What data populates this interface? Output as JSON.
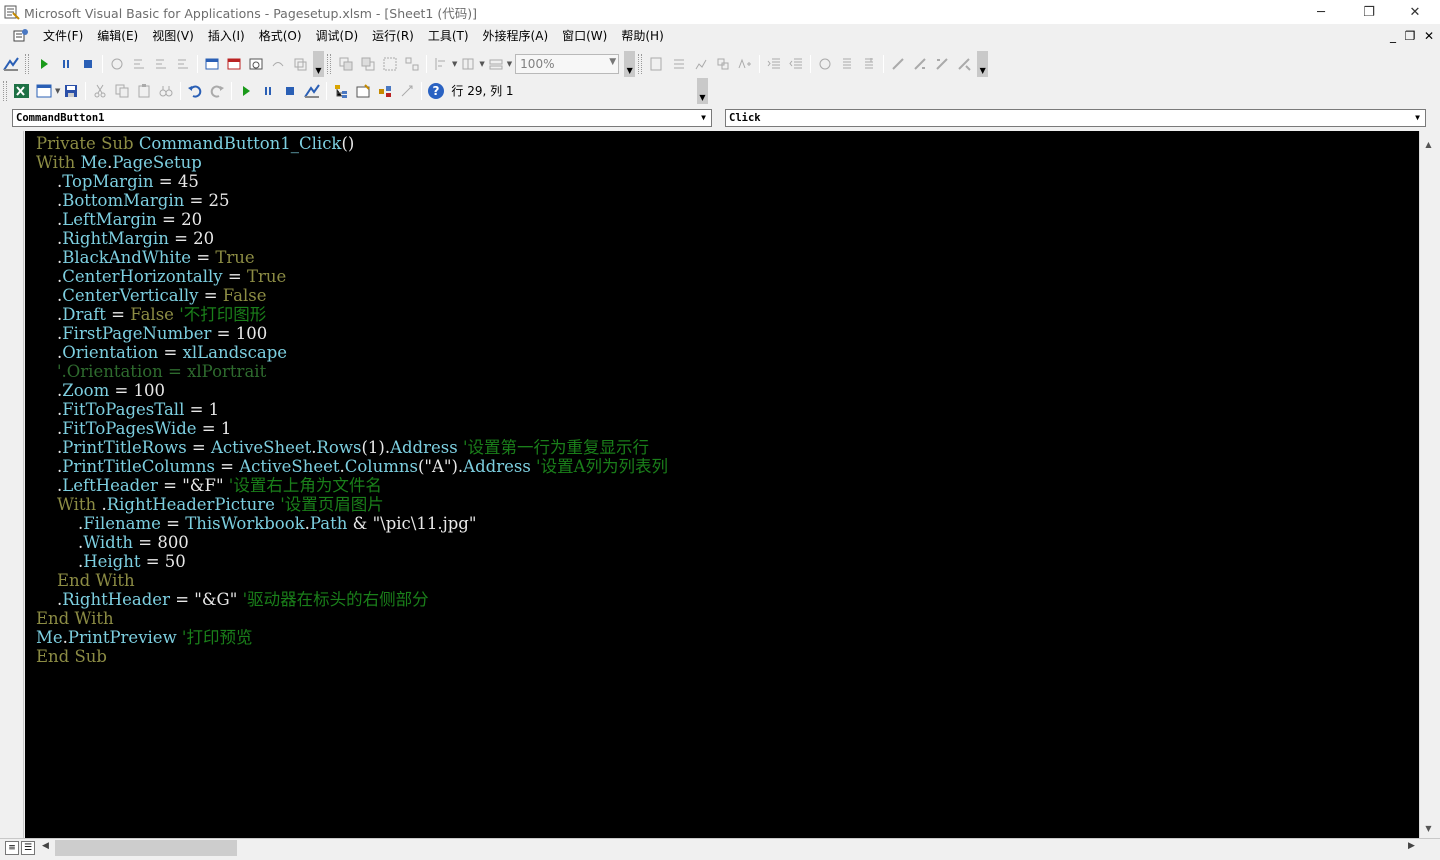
{
  "window": {
    "title": "Microsoft Visual Basic for Applications - Pagesetup.xlsm - [Sheet1 (代码)]",
    "minimize": "─",
    "restore": "❐",
    "close": "✕"
  },
  "menu": {
    "items": [
      "文件(F)",
      "编辑(E)",
      "视图(V)",
      "插入(I)",
      "格式(O)",
      "调试(D)",
      "运行(R)",
      "工具(T)",
      "外接程序(A)",
      "窗口(W)",
      "帮助(H)"
    ],
    "mdi_min": "_",
    "mdi_restore": "❐",
    "mdi_close": "✕"
  },
  "toolbar2": {
    "zoom": "100%"
  },
  "toolbar3": {
    "help_glyph": "?",
    "position": "行 29, 列 1"
  },
  "combos": {
    "object": "CommandButton1",
    "procedure": "Click"
  },
  "code": {
    "lines": [
      [
        [
          "kw",
          "Private Sub "
        ],
        [
          "id",
          "CommandButton1_Click"
        ],
        [
          "op",
          "()"
        ]
      ],
      [
        [
          "kw",
          "With "
        ],
        [
          "id",
          "Me"
        ],
        [
          "op",
          "."
        ],
        [
          "id",
          "PageSetup"
        ]
      ],
      [
        [
          "op",
          "    ."
        ],
        [
          "id",
          "TopMargin"
        ],
        [
          "op",
          " = 45"
        ]
      ],
      [
        [
          "op",
          "    ."
        ],
        [
          "id",
          "BottomMargin"
        ],
        [
          "op",
          " = 25"
        ]
      ],
      [
        [
          "op",
          "    ."
        ],
        [
          "id",
          "LeftMargin"
        ],
        [
          "op",
          " = 20"
        ]
      ],
      [
        [
          "op",
          "    ."
        ],
        [
          "id",
          "RightMargin"
        ],
        [
          "op",
          " = 20"
        ]
      ],
      [
        [
          "op",
          "    ."
        ],
        [
          "id",
          "BlackAndWhite"
        ],
        [
          "op",
          " = "
        ],
        [
          "kw",
          "True"
        ]
      ],
      [
        [
          "op",
          "    ."
        ],
        [
          "id",
          "CenterHorizontally"
        ],
        [
          "op",
          " = "
        ],
        [
          "kw",
          "True"
        ]
      ],
      [
        [
          "op",
          "    ."
        ],
        [
          "id",
          "CenterVertically"
        ],
        [
          "op",
          " = "
        ],
        [
          "kw",
          "False"
        ]
      ],
      [
        [
          "op",
          "    ."
        ],
        [
          "id",
          "Draft"
        ],
        [
          "op",
          " = "
        ],
        [
          "kw",
          "False"
        ],
        [
          "cm",
          " '不打印图形"
        ]
      ],
      [
        [
          "op",
          "    ."
        ],
        [
          "id",
          "FirstPageNumber"
        ],
        [
          "op",
          " = 100"
        ]
      ],
      [
        [
          "op",
          "    ."
        ],
        [
          "id",
          "Orientation"
        ],
        [
          "op",
          " = "
        ],
        [
          "id",
          "xlLandscape"
        ]
      ],
      [
        [
          "cmt",
          "    '.Orientation = xlPortrait"
        ]
      ],
      [
        [
          "op",
          "    ."
        ],
        [
          "id",
          "Zoom"
        ],
        [
          "op",
          " = 100"
        ]
      ],
      [
        [
          "op",
          "    ."
        ],
        [
          "id",
          "FitToPagesTall"
        ],
        [
          "op",
          " = 1"
        ]
      ],
      [
        [
          "op",
          "    ."
        ],
        [
          "id",
          "FitToPagesWide"
        ],
        [
          "op",
          " = 1"
        ]
      ],
      [
        [
          "op",
          "    ."
        ],
        [
          "id",
          "PrintTitleRows"
        ],
        [
          "op",
          " = "
        ],
        [
          "id",
          "ActiveSheet"
        ],
        [
          "op",
          "."
        ],
        [
          "id",
          "Rows"
        ],
        [
          "op",
          "(1)."
        ],
        [
          "id",
          "Address"
        ],
        [
          "cm",
          " '设置第一行为重复显示行"
        ]
      ],
      [
        [
          "op",
          "    ."
        ],
        [
          "id",
          "PrintTitleColumns"
        ],
        [
          "op",
          " = "
        ],
        [
          "id",
          "ActiveSheet"
        ],
        [
          "op",
          "."
        ],
        [
          "id",
          "Columns"
        ],
        [
          "op",
          "(\"A\")."
        ],
        [
          "id",
          "Address"
        ],
        [
          "cm",
          " '设置A列为列表列"
        ]
      ],
      [
        [
          "op",
          "    ."
        ],
        [
          "id",
          "LeftHeader"
        ],
        [
          "op",
          " = \"&F\""
        ],
        [
          "cm",
          " '设置右上角为文件名"
        ]
      ],
      [
        [
          "kw",
          "    With "
        ],
        [
          "op",
          "."
        ],
        [
          "id",
          "RightHeaderPicture"
        ],
        [
          "cm",
          " '设置页眉图片"
        ]
      ],
      [
        [
          "op",
          "        ."
        ],
        [
          "id",
          "Filename"
        ],
        [
          "op",
          " = "
        ],
        [
          "id",
          "ThisWorkbook"
        ],
        [
          "op",
          "."
        ],
        [
          "id",
          "Path"
        ],
        [
          "op",
          " & \"\\pic\\11.jpg\""
        ]
      ],
      [
        [
          "op",
          "        ."
        ],
        [
          "id",
          "Width"
        ],
        [
          "op",
          " = 800"
        ]
      ],
      [
        [
          "op",
          "        ."
        ],
        [
          "id",
          "Height"
        ],
        [
          "op",
          " = 50"
        ]
      ],
      [
        [
          "kw",
          "    End With"
        ]
      ],
      [
        [
          "op",
          "    ."
        ],
        [
          "id",
          "RightHeader"
        ],
        [
          "op",
          " = \"&G\""
        ],
        [
          "cm",
          " '驱动器在标头的右侧部分"
        ]
      ],
      [
        [
          "kw",
          "End With"
        ]
      ],
      [
        [
          "id",
          "Me"
        ],
        [
          "op",
          "."
        ],
        [
          "id",
          "PrintPreview"
        ],
        [
          "cm",
          " '打印预览"
        ]
      ],
      [
        [
          "kw",
          "End Sub"
        ]
      ]
    ]
  },
  "scroll": {
    "up": "▲",
    "down": "▼",
    "left": "◀",
    "right": "▶",
    "view_procedure": "≡",
    "view_module": "☰"
  }
}
